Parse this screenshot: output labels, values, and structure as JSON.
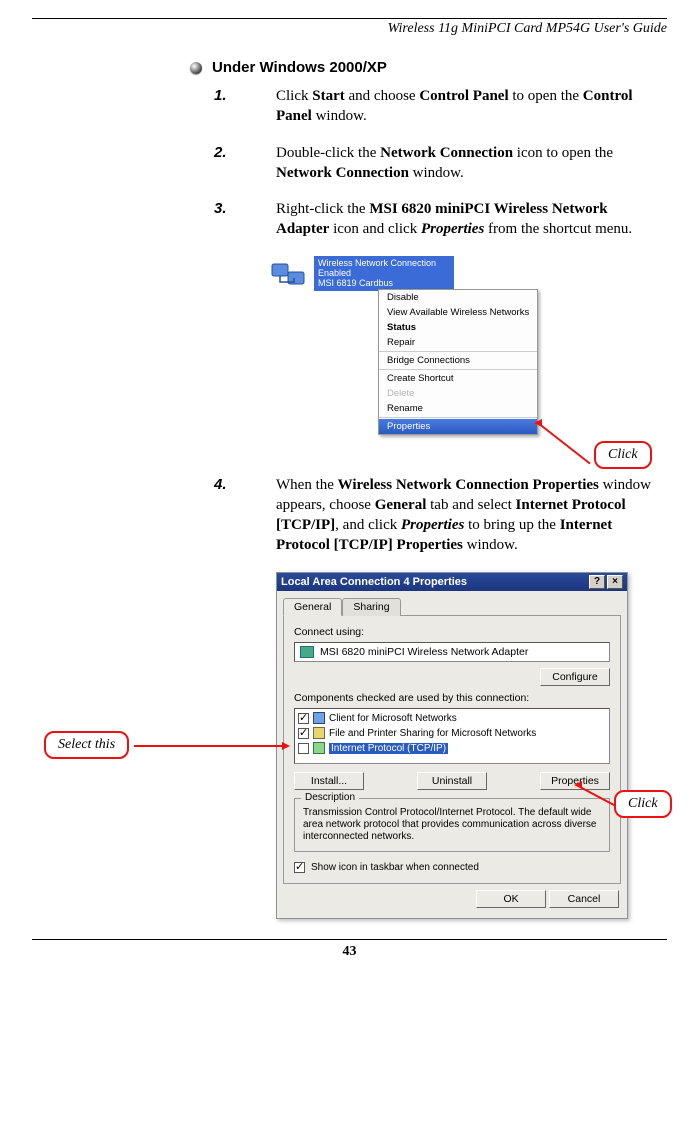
{
  "header": "Wireless 11g MiniPCI Card MP54G User's Guide",
  "section_heading": "Under Windows 2000/XP",
  "steps": [
    {
      "num": "1.",
      "html": "Click <b>Start</b> and choose <b>Control Panel</b> to open the <b>Control Panel</b> window."
    },
    {
      "num": "2.",
      "html": "Double-click the <b>Network Connection</b> icon to open the <b>Network Connection</b> window."
    },
    {
      "num": "3.",
      "html": "Right-click the <b>MSI 6820 miniPCI Wireless Network Adapter</b> icon and click <i class=\"bi\">Properties</i> from the shortcut menu."
    },
    {
      "num": "4.",
      "html": "When the <b>Wireless Network Connection Properties</b> window appears, choose <b>General</b> tab and select <b>Internet Protocol [TCP/IP]</b>, and click <i class=\"bi\">Properties</i> to bring up the <b>Internet Protocol [TCP/IP] Properties</b> window."
    }
  ],
  "nc_title": {
    "line1": "Wireless Network Connection",
    "line2": "Enabled",
    "line3": "MSI 6819 Cardbus"
  },
  "ctx_menu": {
    "disable": "Disable",
    "view": "View Available Wireless Networks",
    "status": "Status",
    "repair": "Repair",
    "bridge": "Bridge Connections",
    "create": "Create Shortcut",
    "delete": "Delete",
    "rename": "Rename",
    "properties": "Properties"
  },
  "callouts": {
    "click": "Click",
    "select_this": "Select this"
  },
  "dialog": {
    "title": "Local Area Connection 4 Properties",
    "tabs": {
      "general": "General",
      "sharing": "Sharing"
    },
    "connect_using_label": "Connect using:",
    "adapter_name": "MSI 6820 miniPCI Wireless Network Adapter",
    "configure_btn": "Configure",
    "components_label": "Components checked are used by this connection:",
    "components": {
      "client": "Client for Microsoft Networks",
      "file": "File and Printer Sharing for Microsoft Networks",
      "tcpip": "Internet Protocol (TCP/IP)"
    },
    "install_btn": "Install...",
    "uninstall_btn": "Uninstall",
    "properties_btn": "Properties",
    "description_legend": "Description",
    "description_text": "Transmission Control Protocol/Internet Protocol. The default wide area network protocol that provides communication across diverse interconnected networks.",
    "show_icon_label": "Show icon in taskbar when connected",
    "ok_btn": "OK",
    "cancel_btn": "Cancel"
  },
  "page_number": "43"
}
